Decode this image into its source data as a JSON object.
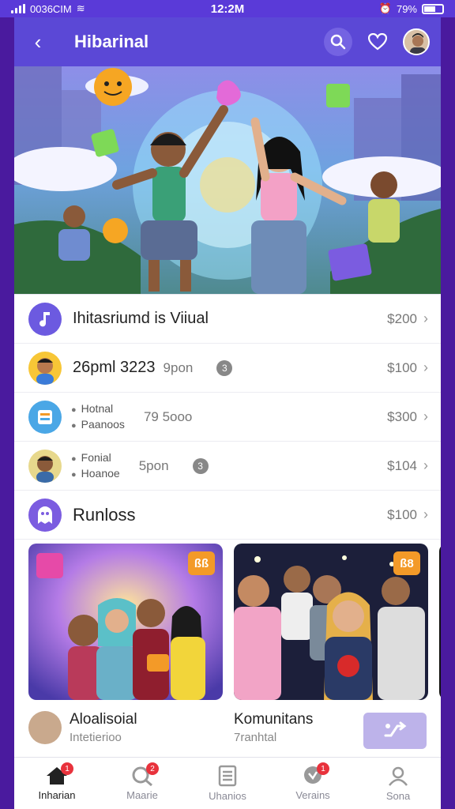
{
  "status": {
    "carrier": "0036CIM",
    "time": "12:2M",
    "battery_pct": "79%"
  },
  "topbar": {
    "title": "Hibarinal"
  },
  "list": [
    {
      "title": "Ihitasriumd is Viiual",
      "price": "$200",
      "icon": "music-note-icon"
    },
    {
      "title": "26pml 3223",
      "sub": "9pon",
      "price": "$100",
      "icon": "avatar"
    },
    {
      "meta1": "Hotnal",
      "meta2": "Paanoos",
      "sub": "79 5ooo",
      "price": "$300",
      "icon": "app-card-icon"
    },
    {
      "meta1": "Fonial",
      "meta2": "Hoanoe",
      "sub": "5pon",
      "price": "$104",
      "icon": "avatar"
    },
    {
      "title": "Runloss",
      "price": "$100",
      "icon": "ghost-icon"
    }
  ],
  "cards": [
    {
      "title": "Aloalisoial",
      "sub": "Intetierioo",
      "badge": "ßß"
    },
    {
      "title": "Komunitans",
      "sub": "7ranhtal",
      "badge": "ß8"
    }
  ],
  "nav": [
    {
      "label": "Inharian",
      "badge": "1"
    },
    {
      "label": "Maarie",
      "badge": "2"
    },
    {
      "label": "Uhanios",
      "badge": ""
    },
    {
      "label": "Verains",
      "badge": "1"
    },
    {
      "label": "Sona",
      "badge": ""
    }
  ]
}
